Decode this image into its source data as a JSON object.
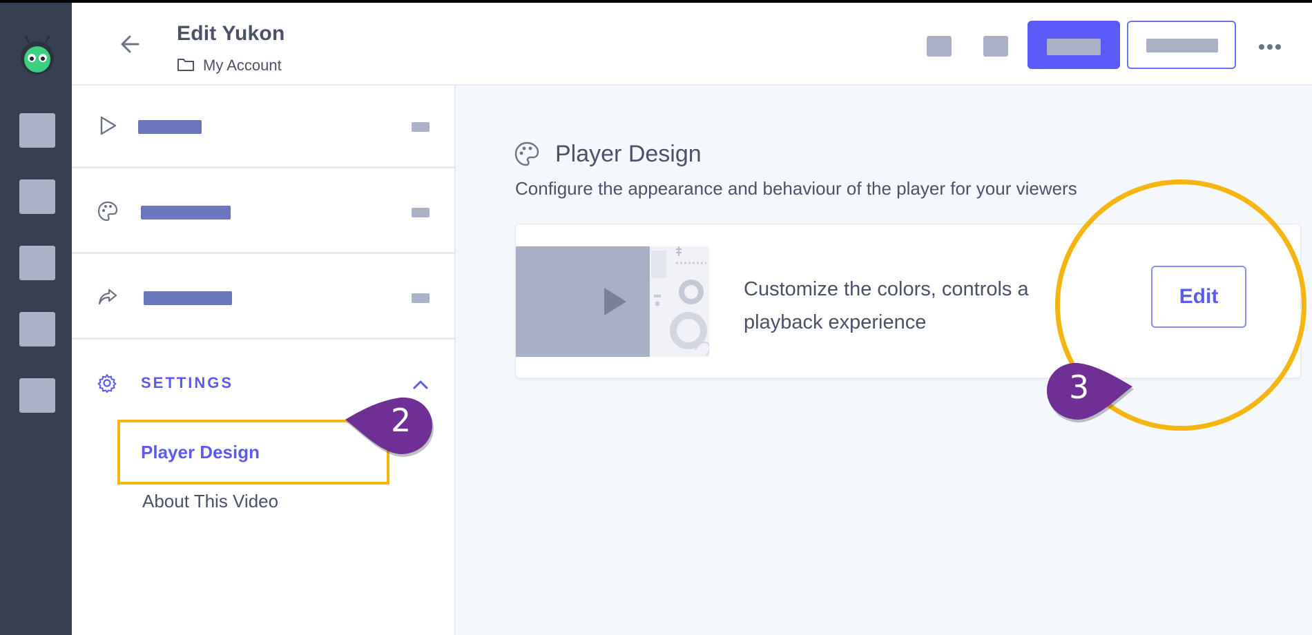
{
  "header": {
    "title": "Edit Yukon",
    "breadcrumb": "My Account"
  },
  "sidebar": {
    "settings": {
      "label": "SETTINGS",
      "items": [
        {
          "label": "Player Design",
          "active": true
        },
        {
          "label": "About This Video",
          "active": false
        }
      ]
    }
  },
  "main": {
    "section_title": "Player Design",
    "section_description": "Configure the appearance and behaviour of the player for your viewers",
    "card": {
      "line1": "Customize the colors, controls a",
      "line2": "playback experience",
      "edit_label": "Edit"
    }
  },
  "annotations": {
    "step_2": "2",
    "step_3": "3"
  },
  "colors": {
    "accent": "#5a5af7",
    "rail": "#373f52",
    "highlight": "#f5b50e",
    "callout": "#6f2f95"
  },
  "icons": [
    "app-logo-icon",
    "back-arrow-icon",
    "folder-icon",
    "more-icon",
    "play-icon",
    "palette-icon",
    "share-icon",
    "gear-icon",
    "chevron-up-icon"
  ]
}
